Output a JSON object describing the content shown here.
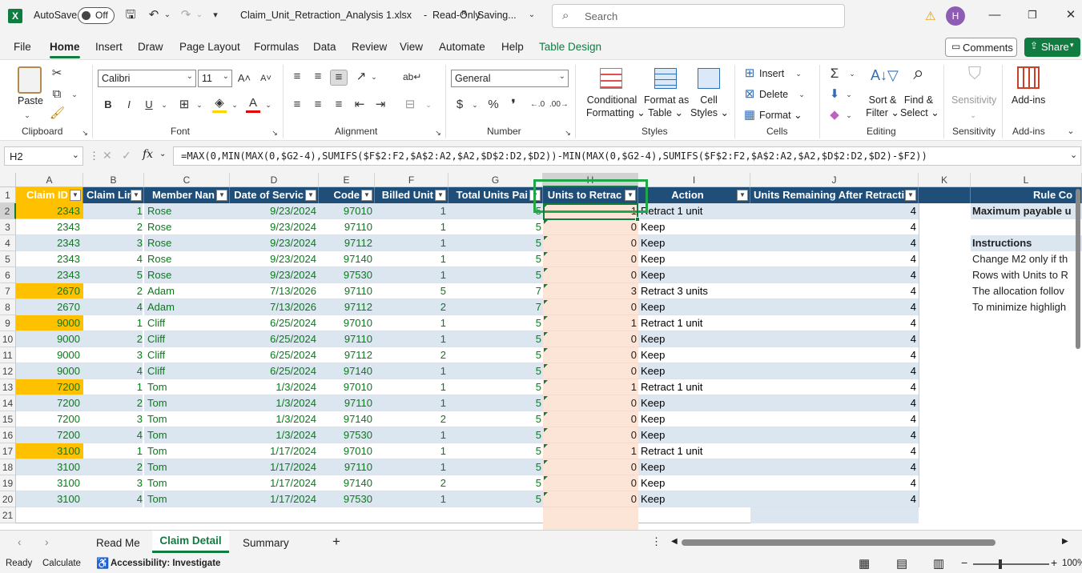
{
  "titlebar": {
    "autosave_label": "AutoSave",
    "autosave_state": "Off",
    "filename": "Claim_Unit_Retraction_Analysis 1.xlsx",
    "status": "Read-Only",
    "saving": "Saving...",
    "search_placeholder": "Search",
    "avatar_initial": "H"
  },
  "menu_tabs": [
    "File",
    "Home",
    "Insert",
    "Draw",
    "Page Layout",
    "Formulas",
    "Data",
    "Review",
    "View",
    "Automate",
    "Help",
    "Table Design"
  ],
  "comments_label": "Comments",
  "share_label": "Share",
  "ribbon": {
    "paste": "Paste",
    "clipboard": "Clipboard",
    "font_name": "Calibri",
    "font_size": "11",
    "font": "Font",
    "alignment": "Alignment",
    "number_format": "General",
    "number": "Number",
    "conditional": "Conditional",
    "formatting": "Formatting",
    "format_as": "Format as",
    "table": "Table",
    "cell": "Cell",
    "styles_lbl": "Styles",
    "styles": "Styles",
    "insert": "Insert",
    "delete": "Delete",
    "format": "Format",
    "cells": "Cells",
    "sort": "Sort &",
    "filter": "Filter",
    "find": "Find &",
    "select": "Select",
    "editing": "Editing",
    "sensitivity": "Sensitivity",
    "sensitivity_group": "Sensitivity",
    "addins": "Add-ins",
    "addins_group": "Add-ins"
  },
  "formula_bar": {
    "name_box": "H2",
    "formula": "=MAX(0,MIN(MAX(0,$G2-4),SUMIFS($F$2:F2,$A$2:A2,$A2,$D$2:D2,$D2))-MIN(MAX(0,$G2-4),SUMIFS($F$2:F2,$A$2:A2,$A2,$D$2:D2,$D2)-$F2))"
  },
  "columns": [
    "A",
    "B",
    "C",
    "D",
    "E",
    "F",
    "G",
    "H",
    "I",
    "J",
    "K",
    "L"
  ],
  "headers": [
    "Claim ID",
    "Claim Lin",
    "Member Nan",
    "Date of Servic",
    "Code",
    "Billed Unit",
    "Total Units Pai",
    "Units to Retrac",
    "Action",
    "Units Remaining After Retracti"
  ],
  "header_L": "Rule Co",
  "rows": [
    [
      "2343",
      "1",
      "Rose",
      "9/23/2024",
      "97010",
      "1",
      "5",
      "1",
      "Retract 1 unit",
      "4"
    ],
    [
      "2343",
      "2",
      "Rose",
      "9/23/2024",
      "97110",
      "1",
      "5",
      "0",
      "Keep",
      "4"
    ],
    [
      "2343",
      "3",
      "Rose",
      "9/23/2024",
      "97112",
      "1",
      "5",
      "0",
      "Keep",
      "4"
    ],
    [
      "2343",
      "4",
      "Rose",
      "9/23/2024",
      "97140",
      "1",
      "5",
      "0",
      "Keep",
      "4"
    ],
    [
      "2343",
      "5",
      "Rose",
      "9/23/2024",
      "97530",
      "1",
      "5",
      "0",
      "Keep",
      "4"
    ],
    [
      "2670",
      "2",
      "Adam",
      "7/13/2026",
      "97110",
      "5",
      "7",
      "3",
      "Retract 3 units",
      "4"
    ],
    [
      "2670",
      "4",
      "Adam",
      "7/13/2026",
      "97112",
      "2",
      "7",
      "0",
      "Keep",
      "4"
    ],
    [
      "9000",
      "1",
      "Cliff",
      "6/25/2024",
      "97010",
      "1",
      "5",
      "1",
      "Retract 1 unit",
      "4"
    ],
    [
      "9000",
      "2",
      "Cliff",
      "6/25/2024",
      "97110",
      "1",
      "5",
      "0",
      "Keep",
      "4"
    ],
    [
      "9000",
      "3",
      "Cliff",
      "6/25/2024",
      "97112",
      "2",
      "5",
      "0",
      "Keep",
      "4"
    ],
    [
      "9000",
      "4",
      "Cliff",
      "6/25/2024",
      "97140",
      "1",
      "5",
      "0",
      "Keep",
      "4"
    ],
    [
      "7200",
      "1",
      "Tom",
      "1/3/2024",
      "97010",
      "1",
      "5",
      "1",
      "Retract 1 unit",
      "4"
    ],
    [
      "7200",
      "2",
      "Tom",
      "1/3/2024",
      "97110",
      "1",
      "5",
      "0",
      "Keep",
      "4"
    ],
    [
      "7200",
      "3",
      "Tom",
      "1/3/2024",
      "97140",
      "2",
      "5",
      "0",
      "Keep",
      "4"
    ],
    [
      "7200",
      "4",
      "Tom",
      "1/3/2024",
      "97530",
      "1",
      "5",
      "0",
      "Keep",
      "4"
    ],
    [
      "3100",
      "1",
      "Tom",
      "1/17/2024",
      "97010",
      "1",
      "5",
      "1",
      "Retract 1 unit",
      "4"
    ],
    [
      "3100",
      "2",
      "Tom",
      "1/17/2024",
      "97110",
      "1",
      "5",
      "0",
      "Keep",
      "4"
    ],
    [
      "3100",
      "3",
      "Tom",
      "1/17/2024",
      "97140",
      "2",
      "5",
      "0",
      "Keep",
      "4"
    ],
    [
      "3100",
      "4",
      "Tom",
      "1/17/2024",
      "97530",
      "1",
      "5",
      "0",
      "Keep",
      "4"
    ]
  ],
  "highlight_color": "#ffc000",
  "rule_text": {
    "r2": "Maximum payable u",
    "r4": "Instructions",
    "r5": "Change M2 only if th",
    "r6": "Rows with Units to R",
    "r7": "The allocation follov",
    "r8": "To minimize highligh"
  },
  "sheet_tabs": [
    "Read Me",
    "Claim Detail",
    "Summary"
  ],
  "active_sheet": "Claim Detail",
  "status": {
    "ready": "Ready",
    "calculate": "Calculate",
    "accessibility": "Accessibility: Investigate",
    "zoom": "100%"
  }
}
